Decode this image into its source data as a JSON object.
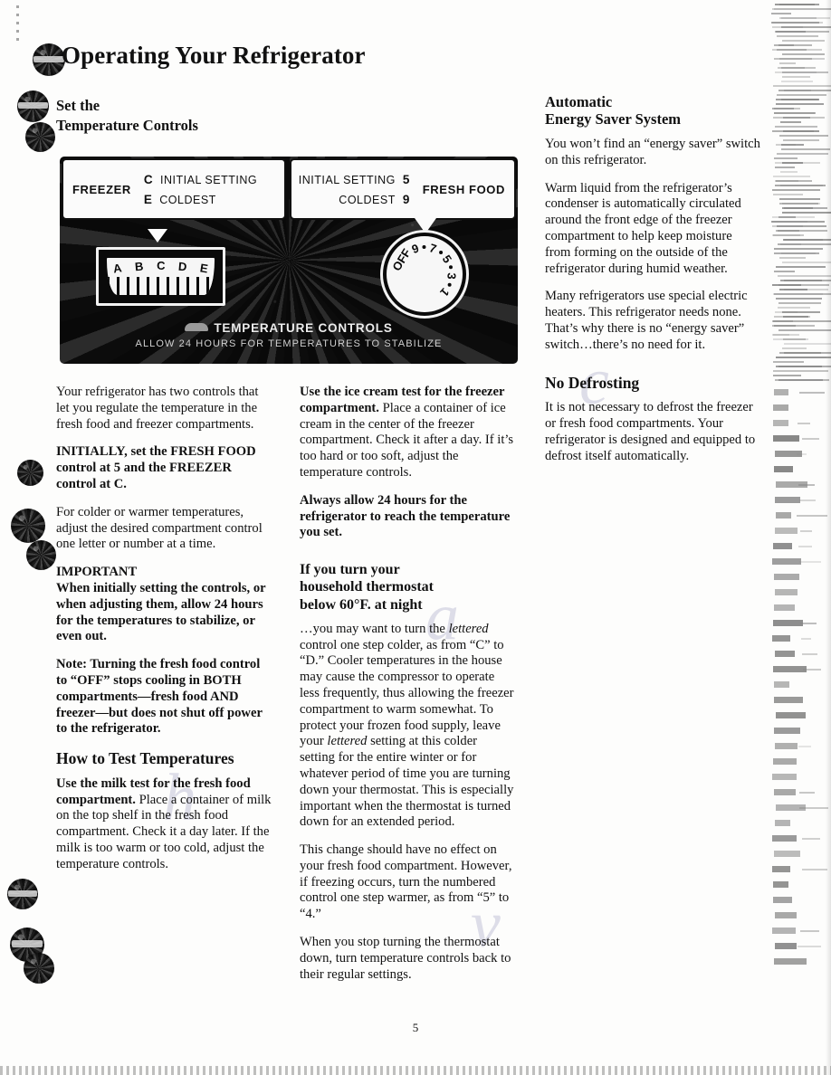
{
  "page": {
    "title": "Operating Your Refrigerator",
    "number": "5"
  },
  "left_column": {
    "section_heading_line1": "Set the",
    "section_heading_line2": "Temperature Controls",
    "paragraphs": {
      "p1": "Your refrigerator has two controls that let you regulate the temperature in the fresh food and freezer compartments.",
      "p2": "INITIALLY, set the FRESH FOOD control at 5 and the FREEZER control at C.",
      "p3": "For colder or warmer temperatures, adjust the desired compartment control one letter or number at a time.",
      "p4_label": "IMPORTANT",
      "p4": "When initially setting the controls, or when adjusting them, allow 24 hours for the temperatures to stabilize, or even out.",
      "p5": "Note: Turning the fresh food control to “OFF” stops cooling in BOTH compartments—fresh food AND freezer—but does not shut off power to the refrigerator."
    },
    "test_heading": "How to Test Temperatures",
    "milk_test_lead": "Use the milk test for the fresh food compartment.",
    "milk_test_body": " Place a container of milk on the top shelf in the fresh food compartment. Check it a day later. If the milk is too warm or too cold, adjust the temperature controls."
  },
  "middle_column": {
    "ice_cream_lead": "Use the ice cream test for the freezer compartment.",
    "ice_cream_body": " Place a container of ice cream in the center of the freezer compartment. Check it after a day. If it’s too hard or too soft, adjust the temperature controls.",
    "allow_24": "Always allow 24 hours for the refrigerator to reach the temperature you set.",
    "thermostat_heading_line1": "If you turn your",
    "thermostat_heading_line2": "household thermostat",
    "thermostat_heading_line3": "below 60°F. at night",
    "p1_a": "…you may want to turn the ",
    "p1_italic1": "lettered",
    "p1_b": " control one step colder, as from “C” to “D.” Cooler temperatures in the house may cause the compressor to operate less frequently, thus allowing the freezer compartment to warm somewhat. To protect your frozen food supply, leave your ",
    "p1_italic2": "lettered",
    "p1_c": " setting at this colder setting for the entire winter or for whatever period of time you are turning down your thermostat. This is especially important when the thermostat is turned down for an extended period.",
    "p2": "This change should have no effect on your fresh food compartment. However, if freezing occurs, turn the numbered control one step warmer, as from “5” to “4.”",
    "p3": "When you stop turning the thermostat down, turn temperature controls back to their regular settings."
  },
  "right_column": {
    "energy_heading_line1": "Automatic",
    "energy_heading_line2": "Energy Saver System",
    "p1": "You won’t find an “energy saver” switch on this refrigerator.",
    "p2": "Warm liquid from the refrigerator’s condenser is automatically circulated around the front edge of the freezer compartment to help keep moisture from forming on the outside of the refrigerator during humid weather.",
    "p3": "Many refrigerators use special electric heaters. This refrigerator needs none. That’s why there is no “energy saver” switch…there’s no need for it.",
    "defrost_heading": "No Defrosting",
    "p4": "It is not necessary to defrost the freezer or fresh food compartments. Your refrigerator is designed and equipped to defrost itself automatically."
  },
  "control_panel": {
    "freezer_label": "FREEZER",
    "freezer_initial_key": "C",
    "freezer_initial_value": "INITIAL SETTING",
    "freezer_coldest_key": "E",
    "freezer_coldest_value": "COLDEST",
    "fresh_food_label": "FRESH FOOD",
    "fresh_initial_value": "INITIAL SETTING",
    "fresh_initial_key": "5",
    "fresh_coldest_value": "COLDEST",
    "fresh_coldest_key": "9",
    "freezer_slider_letters": [
      "A",
      "B",
      "C",
      "D",
      "E"
    ],
    "fresh_dial_marks": [
      "OFF",
      "9",
      "7",
      "5",
      "3",
      "1"
    ],
    "caption_main": "TEMPERATURE CONTROLS",
    "caption_sub": "ALLOW 24 HOURS FOR TEMPERATURES TO STABILIZE"
  }
}
